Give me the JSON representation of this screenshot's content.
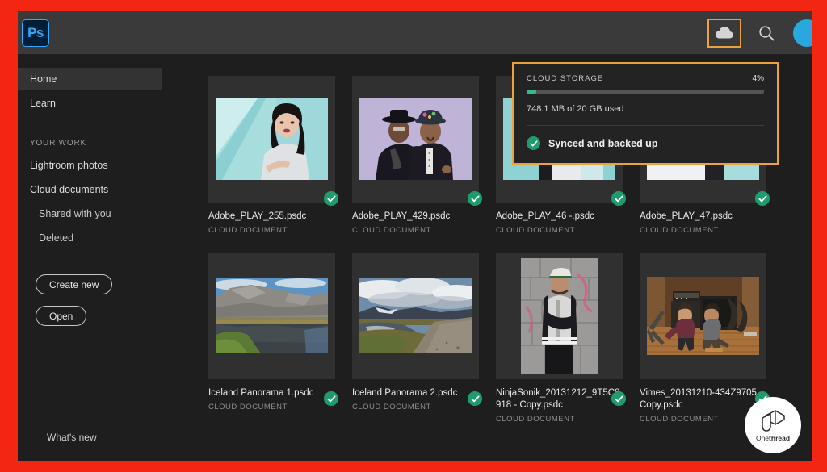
{
  "app": {
    "logo_text": "Ps",
    "accent_highlight": "#e8a33d",
    "brand_blue": "#31a8ff"
  },
  "titlebar": {
    "cloud_icon": "cloud-icon",
    "search_icon": "search-icon",
    "avatar": "user-avatar"
  },
  "sidebar": {
    "items": [
      {
        "label": "Home",
        "active": true
      },
      {
        "label": "Learn",
        "active": false
      }
    ],
    "section_label": "YOUR WORK",
    "work_items": [
      {
        "label": "Lightroom photos",
        "indent": false
      },
      {
        "label": "Cloud documents",
        "indent": false
      },
      {
        "label": "Shared with you",
        "indent": true
      },
      {
        "label": "Deleted",
        "indent": true
      }
    ],
    "create_new_label": "Create new",
    "open_label": "Open",
    "whats_new_label": "What's new"
  },
  "cloud_popup": {
    "title": "CLOUD STORAGE",
    "percent_label": "4%",
    "percent_value": 4,
    "usage_text": "748.1 MB of 20 GB used",
    "sync_status": "Synced and backed up",
    "fill_color": "#2fbd8d",
    "border_color": "#e8a33d"
  },
  "files": {
    "type_label": "CLOUD DOCUMENT",
    "row1": [
      {
        "name": "Adobe_PLAY_255.psdc",
        "type": "CLOUD DOCUMENT",
        "thumb": "portrait-woman-teal",
        "synced": true
      },
      {
        "name": "Adobe_PLAY_429.psdc",
        "type": "CLOUD DOCUMENT",
        "thumb": "two-men-lavender",
        "synced": true
      },
      {
        "name": "Adobe_PLAY_46 -.psdc",
        "type": "CLOUD DOCUMENT",
        "thumb": "portrait-teal-occluded",
        "synced": true
      },
      {
        "name": "Adobe_PLAY_47.psdc",
        "type": "CLOUD DOCUMENT",
        "thumb": "portrait-teal-occluded-2",
        "synced": true
      }
    ],
    "row2": [
      {
        "name": "Iceland Panorama 1.psdc",
        "type": "CLOUD DOCUMENT",
        "thumb": "iceland-mountain-lake",
        "synced": true
      },
      {
        "name": "Iceland Panorama 2.psdc",
        "type": "CLOUD DOCUMENT",
        "thumb": "iceland-road-marsh",
        "synced": true
      },
      {
        "name": "NinjaSonik_20131212_9T5C8918 - Copy.psdc",
        "type": "CLOUD DOCUMENT",
        "thumb": "man-graffiti-wall",
        "synced": true
      },
      {
        "name": "Vimes_20131210-434Z9705 - Copy.psdc",
        "type": "CLOUD DOCUMENT",
        "thumb": "studio-two-men",
        "synced": true
      }
    ]
  },
  "watermark": {
    "text_light": "One",
    "text_bold": "thread"
  }
}
